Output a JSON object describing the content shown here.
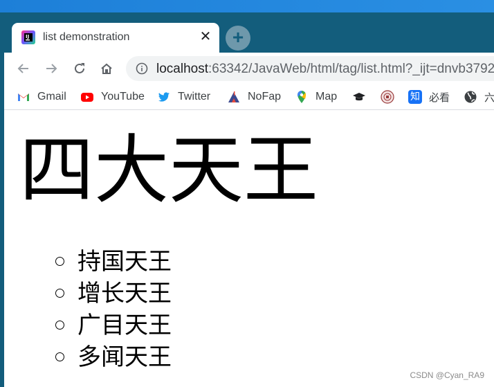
{
  "browser": {
    "tab": {
      "title": "list demonstration",
      "favicon": "jetbrains-icon",
      "close": "✕"
    },
    "new_tab": "+",
    "address_bar": {
      "host": "localhost",
      "path": ":63342/JavaWeb/html/tag/list.html?_ijt=dnvb3792"
    },
    "bookmarks": [
      {
        "label": "Gmail",
        "icon": "gmail-icon"
      },
      {
        "label": "YouTube",
        "icon": "youtube-icon"
      },
      {
        "label": "Twitter",
        "icon": "twitter-icon"
      },
      {
        "label": "NoFap",
        "icon": "nofap-icon"
      },
      {
        "label": "Map",
        "icon": "maps-pin-icon"
      },
      {
        "label": "",
        "icon": "graduation-cap-icon"
      },
      {
        "label": "",
        "icon": "university-seal-icon"
      },
      {
        "label": "必看",
        "icon": "zhihu-icon",
        "icon_text": "知"
      },
      {
        "label": "六",
        "icon": "globe-icon"
      }
    ]
  },
  "page": {
    "heading": "四大天王",
    "list_items": [
      "持国天王",
      "增长天王",
      "广目天王",
      "多闻天王"
    ]
  },
  "watermark": "CSDN @Cyan_RA9",
  "colors": {
    "tabstrip": "#135d7c",
    "desktop": "#1d7fd8",
    "omnibox": "#f1f3f4"
  }
}
